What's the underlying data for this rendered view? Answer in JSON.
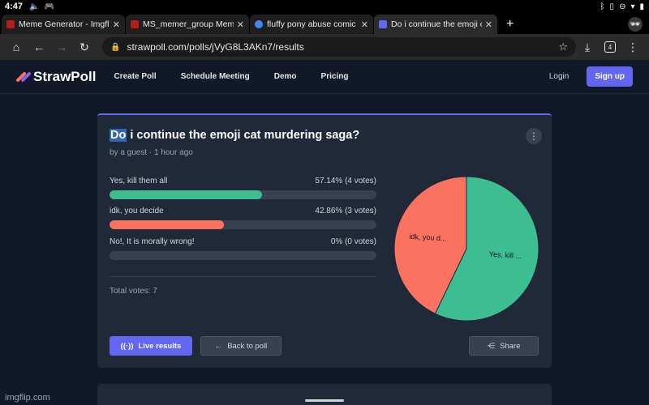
{
  "status_bar": {
    "time": "4:47"
  },
  "tabs": [
    {
      "title": "Meme Generator - Imgflip",
      "favicon_color": "#b71c1c"
    },
    {
      "title": "MS_memer_group Meme",
      "favicon_color": "#b71c1c"
    },
    {
      "title": "fluffy pony abuse comic",
      "favicon_color": "#4285f4"
    },
    {
      "title": "Do i continue the emoji cat",
      "favicon_color": "#6366f1"
    }
  ],
  "toolbar": {
    "url": "strawpoll.com/polls/jVyG8L3AKn7/results",
    "tab_count": "4"
  },
  "site": {
    "logo_text": "StrawPoll",
    "nav": [
      "Create Poll",
      "Schedule Meeting",
      "Demo",
      "Pricing"
    ],
    "login": "Login",
    "signup": "Sign up"
  },
  "poll": {
    "title_highlight": "Do",
    "title_rest": " i continue the emoji cat murdering saga?",
    "byline": "by a guest · 1 hour ago",
    "options": [
      {
        "label": "Yes, kill them all",
        "result": "57.14% (4 votes)",
        "percent": 57.14,
        "color": "#3ebd93"
      },
      {
        "label": "idk, you decide",
        "result": "42.86% (3 votes)",
        "percent": 42.86,
        "color": "#fb7261"
      },
      {
        "label": "No!, It is morally wrong!",
        "result": "0% (0 votes)",
        "percent": 0,
        "color": "#6366f1"
      }
    ],
    "total": "Total votes: 7",
    "pie_labels": [
      "Yes, kill ...",
      "idk, you d..."
    ],
    "buttons": {
      "live": "Live results",
      "back": "Back to poll",
      "share": "Share"
    }
  },
  "watermark": "imgflip.com"
}
